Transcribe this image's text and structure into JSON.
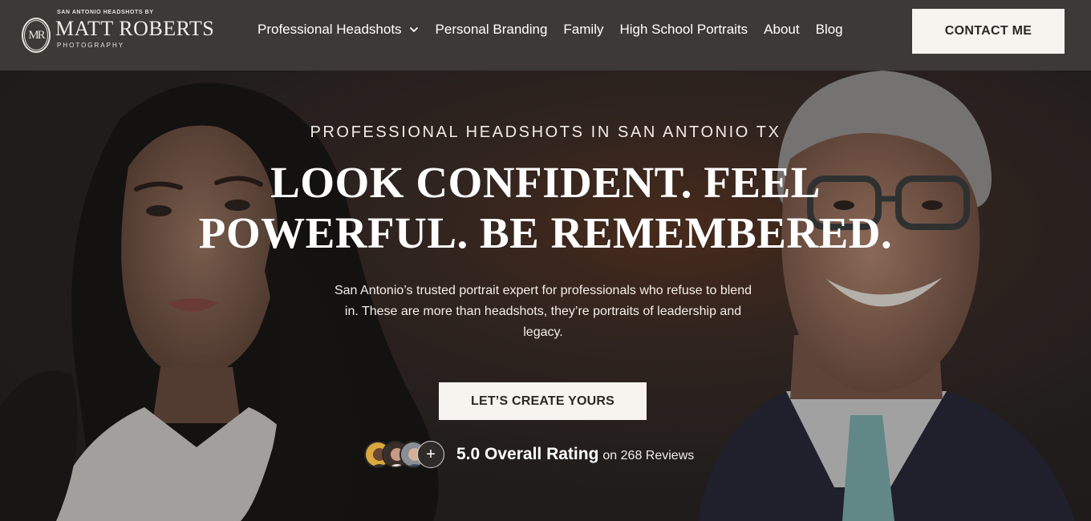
{
  "brand": {
    "tagline_top": "SAN ANTONIO HEADSHOTS BY",
    "name": "MATT ROBERTS",
    "subtitle": "PHOTOGRAPHY",
    "monogram": "MR"
  },
  "nav": {
    "items": [
      {
        "label": "Professional Headshots",
        "has_dropdown": true
      },
      {
        "label": "Personal Branding"
      },
      {
        "label": "Family"
      },
      {
        "label": "High School Portraits"
      },
      {
        "label": "About"
      },
      {
        "label": "Blog"
      }
    ],
    "contact_label": "CONTACT ME"
  },
  "hero": {
    "eyebrow": "PROFESSIONAL HEADSHOTS IN SAN ANTONIO TX",
    "headline_line1": "LOOK CONFIDENT. FEEL",
    "headline_line2": "POWERFUL. BE REMEMBERED.",
    "lede": "San Antonio’s trusted portrait expert for professionals who refuse to blend in. These are more than headshots, they’re portraits of leadership and legacy.",
    "cta_label": "LET’S CREATE YOURS"
  },
  "rating": {
    "main": "5.0 Overall Rating",
    "sub": "on 268 Reviews",
    "plus_icon": "+"
  },
  "colors": {
    "header_bg": "#3d3937",
    "button_bg": "#f7f3ee",
    "button_text": "#2b2725",
    "hero_bg": "#262221",
    "accent_glow": "#5b3420"
  }
}
